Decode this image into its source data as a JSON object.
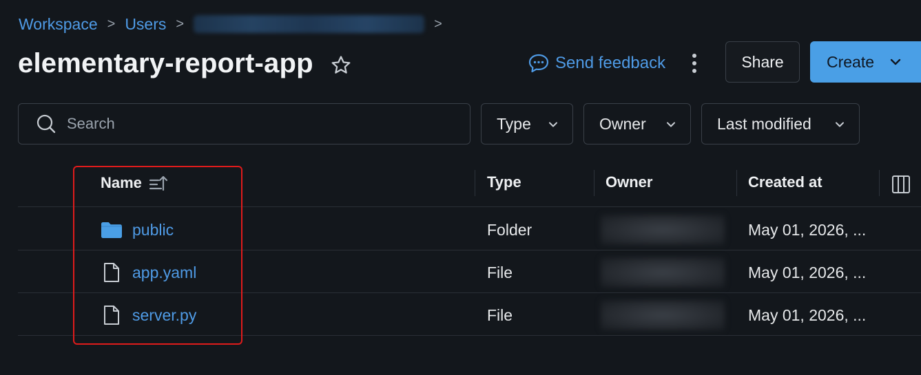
{
  "breadcrumb": {
    "items": [
      "Workspace",
      "Users"
    ],
    "separator": ">"
  },
  "title": "elementary-report-app",
  "header": {
    "feedback_label": "Send feedback",
    "share_label": "Share",
    "create_label": "Create"
  },
  "search": {
    "placeholder": "Search"
  },
  "filters": [
    {
      "label": "Type"
    },
    {
      "label": "Owner"
    },
    {
      "label": "Last modified"
    }
  ],
  "table": {
    "columns": [
      "Name",
      "Type",
      "Owner",
      "Created at"
    ],
    "rows": [
      {
        "icon": "folder-icon",
        "name": "public",
        "type": "Folder",
        "created_at": "May 01, 2026, ..."
      },
      {
        "icon": "file-icon",
        "name": "app.yaml",
        "type": "File",
        "created_at": "May 01, 2026, ..."
      },
      {
        "icon": "file-icon",
        "name": "server.py",
        "type": "File",
        "created_at": "May 01, 2026, ..."
      }
    ]
  },
  "colors": {
    "background": "#13171c",
    "link": "#4f9be6",
    "primary_button": "#4a9fe6",
    "highlight": "#e01b1b"
  }
}
